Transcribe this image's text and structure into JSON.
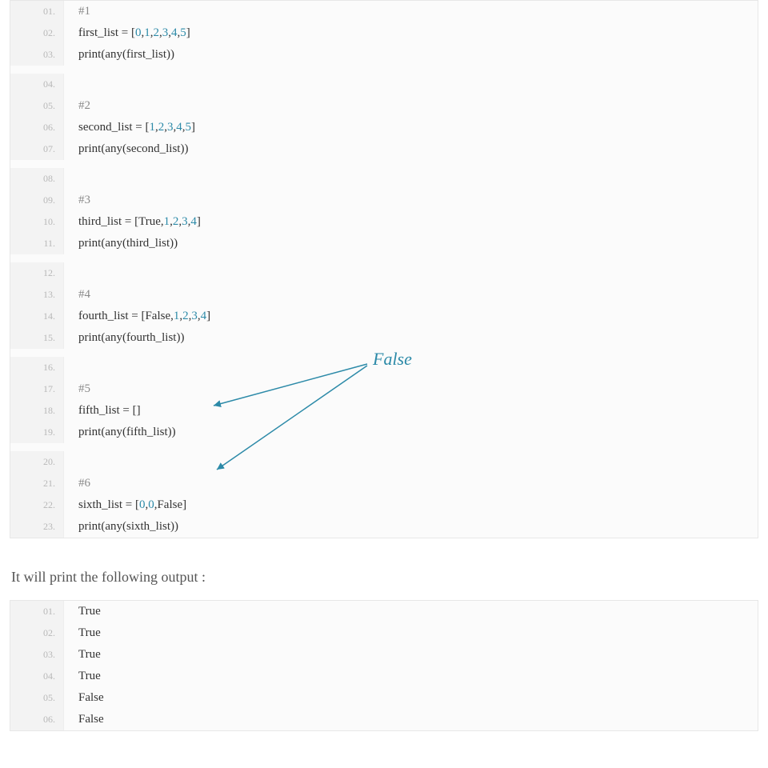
{
  "code1": {
    "lines": [
      {
        "n": "01.",
        "tokens": [
          {
            "t": "#1",
            "c": "comment"
          }
        ]
      },
      {
        "n": "02.",
        "tokens": [
          {
            "t": "first_list = [",
            "c": ""
          },
          {
            "t": "0",
            "c": "num"
          },
          {
            "t": ",",
            "c": ""
          },
          {
            "t": "1",
            "c": "num"
          },
          {
            "t": ",",
            "c": ""
          },
          {
            "t": "2",
            "c": "num"
          },
          {
            "t": ",",
            "c": ""
          },
          {
            "t": "3",
            "c": "num"
          },
          {
            "t": ",",
            "c": ""
          },
          {
            "t": "4",
            "c": "num"
          },
          {
            "t": ",",
            "c": ""
          },
          {
            "t": "5",
            "c": "num"
          },
          {
            "t": "]",
            "c": ""
          }
        ]
      },
      {
        "n": "03.",
        "tokens": [
          {
            "t": "print(any(first_list))",
            "c": ""
          }
        ]
      },
      {
        "n": "04.",
        "tokens": []
      },
      {
        "n": "05.",
        "tokens": [
          {
            "t": "#2",
            "c": "comment"
          }
        ]
      },
      {
        "n": "06.",
        "tokens": [
          {
            "t": "second_list = [",
            "c": ""
          },
          {
            "t": "1",
            "c": "num"
          },
          {
            "t": ",",
            "c": ""
          },
          {
            "t": "2",
            "c": "num"
          },
          {
            "t": ",",
            "c": ""
          },
          {
            "t": "3",
            "c": "num"
          },
          {
            "t": ",",
            "c": ""
          },
          {
            "t": "4",
            "c": "num"
          },
          {
            "t": ",",
            "c": ""
          },
          {
            "t": "5",
            "c": "num"
          },
          {
            "t": "]",
            "c": ""
          }
        ]
      },
      {
        "n": "07.",
        "tokens": [
          {
            "t": "print(any(second_list))",
            "c": ""
          }
        ]
      },
      {
        "n": "08.",
        "tokens": []
      },
      {
        "n": "09.",
        "tokens": [
          {
            "t": "#3",
            "c": "comment"
          }
        ]
      },
      {
        "n": "10.",
        "tokens": [
          {
            "t": "third_list = [True,",
            "c": ""
          },
          {
            "t": "1",
            "c": "num"
          },
          {
            "t": ",",
            "c": ""
          },
          {
            "t": "2",
            "c": "num"
          },
          {
            "t": ",",
            "c": ""
          },
          {
            "t": "3",
            "c": "num"
          },
          {
            "t": ",",
            "c": ""
          },
          {
            "t": "4",
            "c": "num"
          },
          {
            "t": "]",
            "c": ""
          }
        ]
      },
      {
        "n": "11.",
        "tokens": [
          {
            "t": "print(any(third_list))",
            "c": ""
          }
        ]
      },
      {
        "n": "12.",
        "tokens": []
      },
      {
        "n": "13.",
        "tokens": [
          {
            "t": "#4",
            "c": "comment"
          }
        ]
      },
      {
        "n": "14.",
        "tokens": [
          {
            "t": "fourth_list = [False,",
            "c": ""
          },
          {
            "t": "1",
            "c": "num"
          },
          {
            "t": ",",
            "c": ""
          },
          {
            "t": "2",
            "c": "num"
          },
          {
            "t": ",",
            "c": ""
          },
          {
            "t": "3",
            "c": "num"
          },
          {
            "t": ",",
            "c": ""
          },
          {
            "t": "4",
            "c": "num"
          },
          {
            "t": "]",
            "c": ""
          }
        ]
      },
      {
        "n": "15.",
        "tokens": [
          {
            "t": "print(any(fourth_list))",
            "c": ""
          }
        ]
      },
      {
        "n": "16.",
        "tokens": []
      },
      {
        "n": "17.",
        "tokens": [
          {
            "t": "#5",
            "c": "comment"
          }
        ]
      },
      {
        "n": "18.",
        "tokens": [
          {
            "t": "fifth_list = []",
            "c": ""
          }
        ]
      },
      {
        "n": "19.",
        "tokens": [
          {
            "t": "print(any(fifth_list))",
            "c": ""
          }
        ]
      },
      {
        "n": "20.",
        "tokens": []
      },
      {
        "n": "21.",
        "tokens": [
          {
            "t": "#6",
            "c": "comment"
          }
        ]
      },
      {
        "n": "22.",
        "tokens": [
          {
            "t": "sixth_list = [",
            "c": ""
          },
          {
            "t": "0",
            "c": "num"
          },
          {
            "t": ",",
            "c": ""
          },
          {
            "t": "0",
            "c": "num"
          },
          {
            "t": ",False]",
            "c": ""
          }
        ]
      },
      {
        "n": "23.",
        "tokens": [
          {
            "t": "print(any(sixth_list))",
            "c": ""
          }
        ]
      }
    ]
  },
  "intro_text": "It will print the following output :",
  "code2": {
    "lines": [
      {
        "n": "01.",
        "tokens": [
          {
            "t": "True",
            "c": ""
          }
        ]
      },
      {
        "n": "02.",
        "tokens": [
          {
            "t": "True",
            "c": ""
          }
        ]
      },
      {
        "n": "03.",
        "tokens": [
          {
            "t": "True",
            "c": ""
          }
        ]
      },
      {
        "n": "04.",
        "tokens": [
          {
            "t": "True",
            "c": ""
          }
        ]
      },
      {
        "n": "05.",
        "tokens": [
          {
            "t": "False",
            "c": ""
          }
        ]
      },
      {
        "n": "06.",
        "tokens": [
          {
            "t": "False",
            "c": ""
          }
        ]
      }
    ]
  },
  "annotation_label": "False"
}
